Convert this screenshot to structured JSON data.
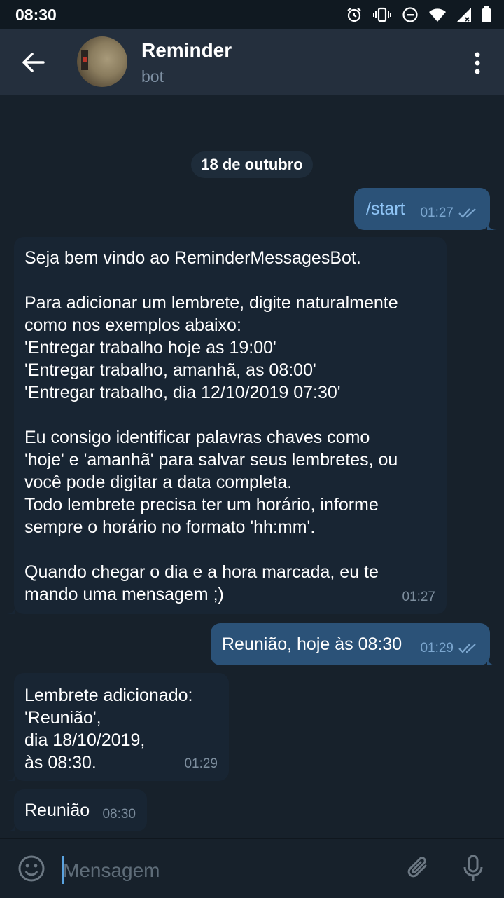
{
  "status_bar": {
    "time": "08:30",
    "icons": [
      "alarm-icon",
      "vibrate-icon",
      "do-not-disturb-icon",
      "wifi-icon",
      "signal-icon",
      "battery-icon"
    ]
  },
  "header": {
    "title": "Reminder",
    "subtitle": "bot",
    "back_icon": "arrow-left-icon",
    "menu_icon": "more-vertical-icon"
  },
  "chat": {
    "date": "18 de outubro",
    "messages": [
      {
        "direction": "out",
        "text": "/start",
        "time": "01:27",
        "read": true
      },
      {
        "direction": "in",
        "text": "Seja bem vindo ao ReminderMessagesBot.\n\nPara adicionar um lembrete, digite naturalmente\ncomo nos exemplos abaixo:\n'Entregar trabalho hoje as 19:00'\n'Entregar trabalho, amanhã, as 08:00'\n'Entregar trabalho, dia 12/10/2019 07:30'\n\nEu consigo identificar palavras chaves como\n'hoje' e 'amanhã' para salvar seus lembretes, ou\nvocê pode digitar a data completa.\nTodo lembrete precisa ter um horário, informe\nsempre o horário no formato 'hh:mm'.\n\nQuando chegar o dia e a hora marcada, eu te\nmando uma mensagem ;)",
        "time": "01:27"
      },
      {
        "direction": "out",
        "text": "Reunião, hoje às 08:30",
        "time": "01:29",
        "read": true
      },
      {
        "direction": "in",
        "text": "Lembrete adicionado:\n'Reunião',\ndia 18/10/2019,\n às 08:30.",
        "time": "01:29"
      },
      {
        "direction": "in",
        "text": "Reunião",
        "time": "08:30"
      }
    ]
  },
  "composer": {
    "placeholder": "Mensagem",
    "value": "",
    "emoji_icon": "smile-icon",
    "attach_icon": "paperclip-icon",
    "mic_icon": "microphone-icon"
  },
  "colors": {
    "background": "#17212b",
    "header": "#242f3d",
    "bubble_out": "#2b5278",
    "bubble_in": "#182533",
    "accent": "#5aa3e0"
  }
}
